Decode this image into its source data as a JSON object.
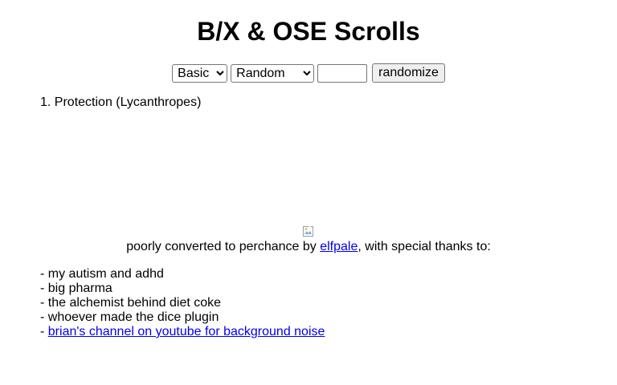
{
  "page": {
    "title": "B/X & OSE Scrolls"
  },
  "controls": {
    "edition_select": {
      "selected": "Basic",
      "options": [
        "Basic"
      ]
    },
    "mode_select": {
      "selected": "Random",
      "options": [
        "Random"
      ]
    },
    "count_input": {
      "value": ""
    },
    "randomize_label": "randomize"
  },
  "results": [
    {
      "number": "1.",
      "text": "Protection (Lycanthropes)"
    }
  ],
  "credit": {
    "image_icon": "broken-image-icon",
    "prefix": "poorly converted to perchance by ",
    "author_link": "elfpale",
    "suffix": ", with special thanks to:"
  },
  "thanks": [
    {
      "bullet": "- ",
      "text": "my autism and adhd"
    },
    {
      "bullet": "- ",
      "text": "big pharma"
    },
    {
      "bullet": "- ",
      "text": "the alchemist behind diet coke"
    },
    {
      "bullet": "- ",
      "text": "whoever made the dice plugin"
    },
    {
      "bullet": "- ",
      "link_text": "brian's channel on youtube for background noise"
    }
  ],
  "colors": {
    "link": "#0000ee",
    "text": "#000000",
    "background": "#ffffff"
  }
}
